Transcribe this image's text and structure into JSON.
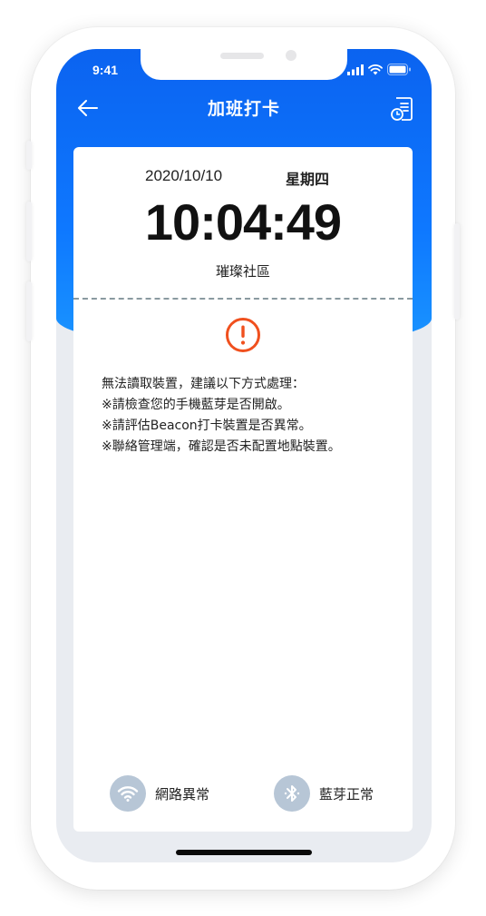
{
  "status_bar": {
    "time": "9:41"
  },
  "nav": {
    "title": "加班打卡"
  },
  "card": {
    "date": "2020/10/10",
    "weekday": "星期四",
    "clock": "10:04:49",
    "community": "璀璨社區"
  },
  "message": {
    "lines": [
      "無法讀取裝置，建議以下方式處理：",
      "※請檢查您的手機藍芽是否開啟。",
      "※請評估Beacon打卡裝置是否異常。",
      "※聯絡管理端，確認是否未配置地點裝置。"
    ]
  },
  "footer": {
    "network_label": "網路異常",
    "bluetooth_label": "藍芽正常"
  },
  "colors": {
    "primary_blue": "#0e78ff",
    "alert_orange": "#f0501e",
    "status_circle": "#b7c6d6"
  },
  "icons": {
    "back": "arrow-left-icon",
    "record": "clock-record-icon",
    "alert": "exclamation-circle-icon",
    "network": "wifi-icon",
    "bluetooth": "bluetooth-icon"
  }
}
